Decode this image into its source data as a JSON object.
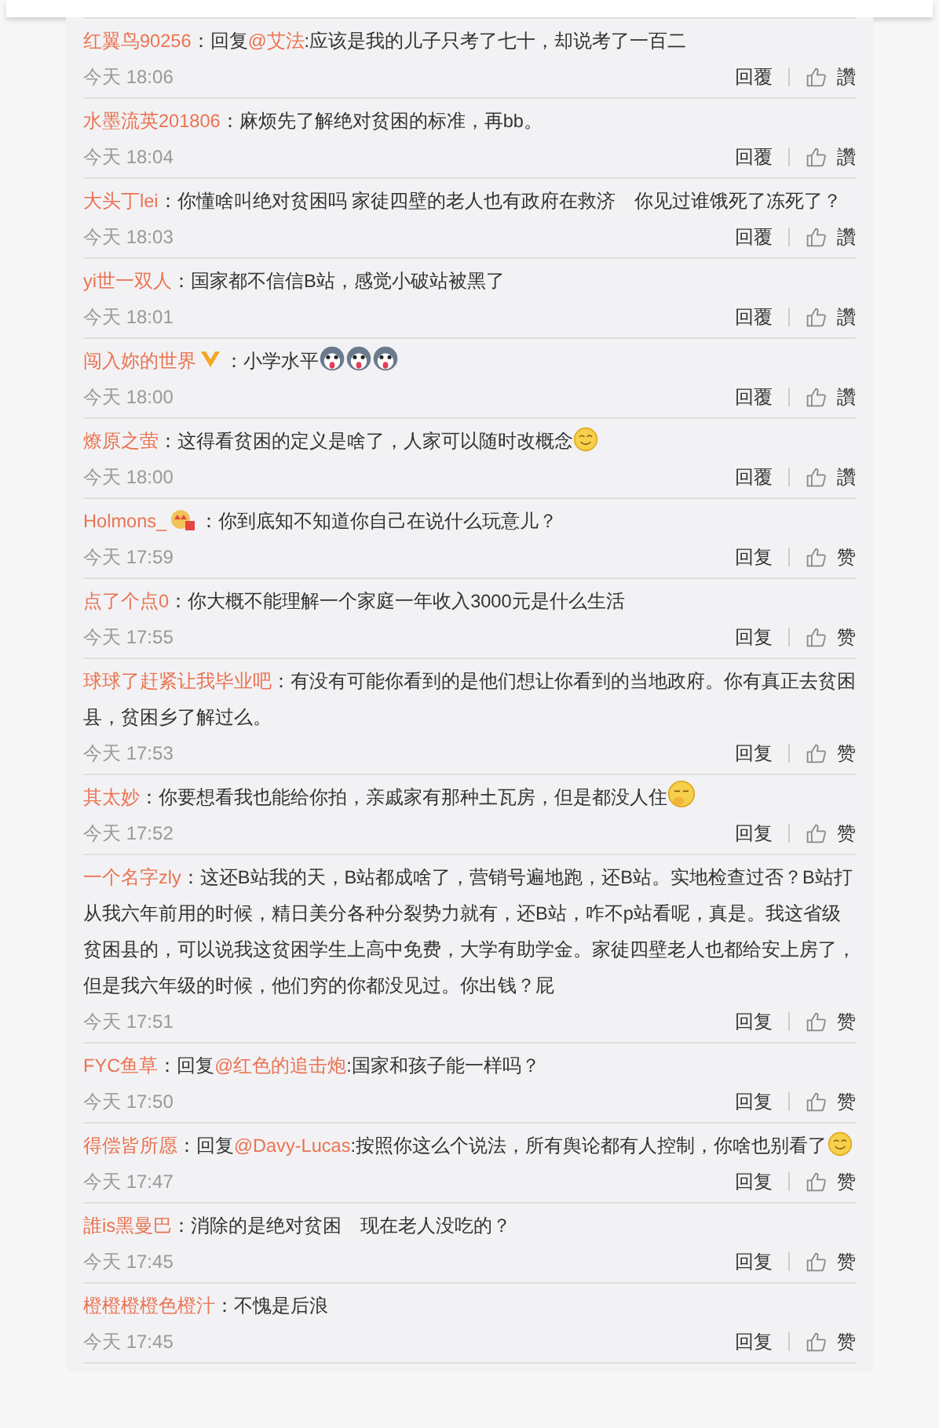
{
  "comments": [
    {
      "user": "红翼鸟90256",
      "separator": "：",
      "reply_to": {
        "prefix": "回复",
        "name": "@艾法",
        "separator": ":"
      },
      "text": "应该是我的儿子只考了七十，却说考了一百二",
      "time": "今天 18:06",
      "reply": "回覆",
      "like": "讚"
    },
    {
      "user": "水墨流英201806",
      "separator": "：",
      "text": "麻烦先了解绝对贫困的标准，再bb。",
      "time": "今天 18:04",
      "reply": "回覆",
      "like": "讚"
    },
    {
      "user": "大头丁lei",
      "separator": "：",
      "text": "你懂啥叫绝对贫困吗 家徒四壁的老人也有政府在救济　你见过谁饿死了冻死了？",
      "time": "今天 18:03",
      "reply": "回覆",
      "like": "讚"
    },
    {
      "user": "yi世一双人",
      "separator": "：",
      "text": "国家都不信信B站，感觉小破站被黑了",
      "time": "今天 18:01",
      "reply": "回覆",
      "like": "讚"
    },
    {
      "user": "闯入妳的世界",
      "badge": {
        "kind": "verified"
      },
      "separator": "：",
      "text": "小学水平",
      "emojis": [
        {
          "kind": "husky"
        },
        {
          "kind": "husky"
        },
        {
          "kind": "husky"
        }
      ],
      "time": "今天 18:00",
      "reply": "回覆",
      "like": "讚"
    },
    {
      "user": "燎原之萤",
      "separator": "：",
      "text": "这得看贫困的定义是啥了，人家可以随时改概念",
      "emojis": [
        {
          "kind": "smile"
        }
      ],
      "time": "今天 18:00",
      "reply": "回覆",
      "like": "讚"
    },
    {
      "user": "Holmons_",
      "badge": {
        "kind": "crown"
      },
      "separator": "：",
      "text": "你到底知不知道你自己在说什么玩意儿？",
      "time": "今天 17:59",
      "reply": "回复",
      "like": "赞"
    },
    {
      "user": "点了个点0",
      "separator": "：",
      "text": "你大概不能理解一个家庭一年收入3000元是什么生活",
      "time": "今天 17:55",
      "reply": "回复",
      "like": "赞"
    },
    {
      "user": "球球了赶紧让我毕业吧",
      "separator": "：",
      "text": "有没有可能你看到的是他们想让你看到的当地政府。你有真正去贫困县，贫困乡了解过么。",
      "time": "今天 17:53",
      "reply": "回复",
      "like": "赞"
    },
    {
      "user": "其太妙",
      "separator": "：",
      "text": "你要想看我也能给你拍，亲戚家有那种土瓦房，但是都没人住",
      "emojis": [
        {
          "kind": "think"
        }
      ],
      "time": "今天 17:52",
      "reply": "回复",
      "like": "赞"
    },
    {
      "user": "一个名字zly",
      "separator": "：",
      "text": "这还B站我的天，B站都成啥了，营销号遍地跑，还B站。实地检查过否？B站打从我六年前用的时候，精日美分各种分裂势力就有，还B站，咋不p站看呢，真是。我这省级贫困县的，可以说我这贫困学生上高中免费，大学有助学金。家徒四壁老人也都给安上房了，但是我六年级的时候，他们穷的你都没见过。你出钱？屁",
      "time": "今天 17:51",
      "reply": "回复",
      "like": "赞"
    },
    {
      "user": "FYC鱼草",
      "separator": "：",
      "reply_to": {
        "prefix": "回复",
        "name": "@红色的追击炮",
        "separator": ":"
      },
      "text": "国家和孩子能一样吗？",
      "time": "今天 17:50",
      "reply": "回复",
      "like": "赞"
    },
    {
      "user": "得偿皆所愿",
      "separator": "：",
      "reply_to": {
        "prefix": "回复",
        "name": "@Davy-Lucas",
        "separator": ":"
      },
      "text": "按照你这么个说法，所有舆论都有人控制，你啥也别看了",
      "emojis": [
        {
          "kind": "smile"
        }
      ],
      "time": "今天 17:47",
      "reply": "回复",
      "like": "赞"
    },
    {
      "user": "誰is黑曼巴",
      "separator": "：",
      "text": "消除的是绝对贫困　现在老人没吃的？",
      "time": "今天 17:45",
      "reply": "回复",
      "like": "赞"
    },
    {
      "user": "橙橙橙橙色橙汁",
      "separator": "：",
      "text": "不愧是后浪",
      "time": "今天 17:45",
      "reply": "回复",
      "like": "赞"
    }
  ]
}
